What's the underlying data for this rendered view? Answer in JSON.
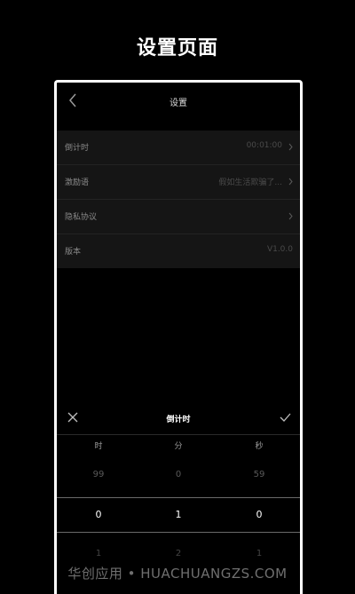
{
  "heading": "设置页面",
  "nav": {
    "title": "设置"
  },
  "settings": [
    {
      "label": "倒计时",
      "value": "00:01:00",
      "chevron": true
    },
    {
      "label": "激励语",
      "value": "假如生活欺骗了...",
      "chevron": true
    },
    {
      "label": "隐私协议",
      "value": "",
      "chevron": true
    },
    {
      "label": "版本",
      "value": "V1.0.0",
      "chevron": false
    }
  ],
  "picker": {
    "title": "倒计时",
    "columns": [
      "时",
      "分",
      "秒"
    ],
    "previous": [
      "99",
      "0",
      "59"
    ],
    "selected": [
      "0",
      "1",
      "0"
    ],
    "next": [
      "1",
      "2",
      "1"
    ]
  },
  "watermark": "华创应用 • HUACHUANGZS.COM",
  "icons": {
    "back": "chevron-left-icon",
    "row": "chevron-right-icon",
    "close": "close-icon",
    "confirm": "checkmark-icon"
  }
}
